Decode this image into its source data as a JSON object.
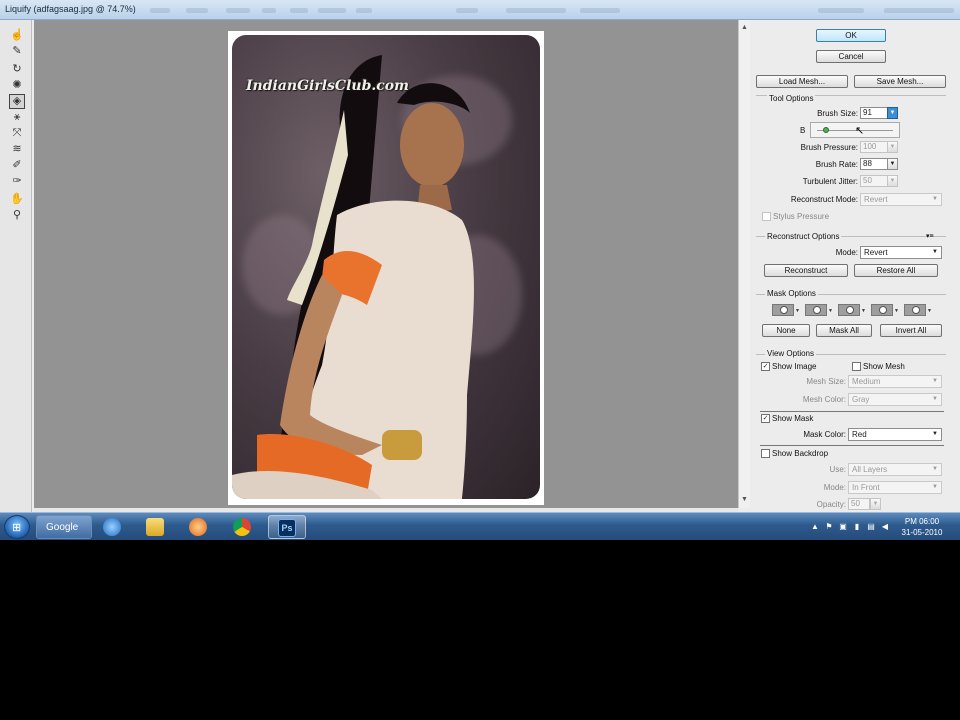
{
  "window": {
    "title": "Liquify (adfagsaag.jpg @ 74.7%)"
  },
  "canvas": {
    "watermark": "IndianGirlsClub.com"
  },
  "panel": {
    "ok": "OK",
    "cancel": "Cancel",
    "load_mesh": "Load Mesh...",
    "save_mesh": "Save Mesh...",
    "tool_options": {
      "title": "Tool Options",
      "brush_size_label": "Brush Size:",
      "brush_size": "91",
      "brush_density_label": "B",
      "brush_pressure_label": "Brush Pressure:",
      "brush_pressure": "100",
      "brush_rate_label": "Brush Rate:",
      "brush_rate": "88",
      "turbulent_jitter_label": "Turbulent Jitter:",
      "turbulent_jitter": "50",
      "reconstruct_mode_label": "Reconstruct Mode:",
      "reconstruct_mode": "Revert",
      "stylus_pressure": "Stylus Pressure"
    },
    "reconstruct_options": {
      "title": "Reconstruct Options",
      "mode_label": "Mode:",
      "mode": "Revert",
      "reconstruct": "Reconstruct",
      "restore_all": "Restore All"
    },
    "mask_options": {
      "title": "Mask Options",
      "none": "None",
      "mask_all": "Mask All",
      "invert_all": "Invert All"
    },
    "view_options": {
      "title": "View Options",
      "show_image": "Show Image",
      "show_mesh": "Show Mesh",
      "mesh_size_label": "Mesh Size:",
      "mesh_size": "Medium",
      "mesh_color_label": "Mesh Color:",
      "mesh_color": "Gray",
      "show_mask": "Show Mask",
      "mask_color_label": "Mask Color:",
      "mask_color": "Red",
      "show_backdrop": "Show Backdrop",
      "use_label": "Use:",
      "use": "All Layers",
      "mode_label": "Mode:",
      "mode": "In Front",
      "opacity_label": "Opacity:",
      "opacity": "50"
    }
  },
  "taskbar": {
    "google": "Google",
    "time": "PM 06:00",
    "date": "31-05-2010"
  }
}
